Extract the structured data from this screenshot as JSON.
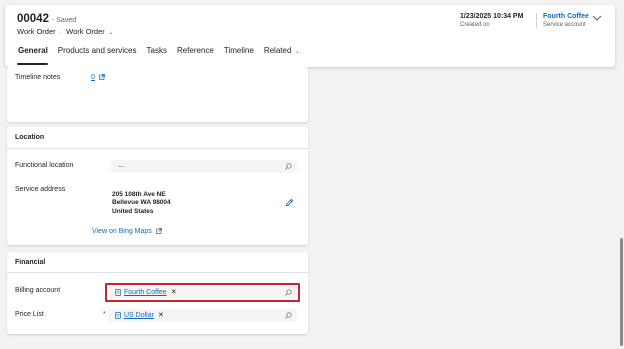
{
  "header": {
    "record_number": "00042",
    "save_status": "- Saved",
    "entity": "Work Order",
    "form": "Work Order",
    "created_on_value": "1/23/2025 10:34 PM",
    "created_on_label": "Created on",
    "service_account_value": "Fourth Coffee",
    "service_account_label": "Service account"
  },
  "tabs": [
    {
      "label": "General",
      "active": true
    },
    {
      "label": "Products and services"
    },
    {
      "label": "Tasks"
    },
    {
      "label": "Reference"
    },
    {
      "label": "Timeline"
    },
    {
      "label": "Related"
    }
  ],
  "sections": {
    "top": {
      "timeline_notes_label": "Timeline notes",
      "timeline_notes_value": "0"
    },
    "location": {
      "title": "Location",
      "functional_location_label": "Functional location",
      "functional_location_value": "---",
      "service_address_label": "Service address",
      "address_line1": "205 108th Ave NE",
      "address_line2": "Bellevue WA 98004",
      "address_line3": "United States",
      "bing_link": "View on Bing Maps"
    },
    "financial": {
      "title": "Financial",
      "billing_account_label": "Billing account",
      "billing_account_value": "Fourth Coffee",
      "price_list_label": "Price List",
      "price_list_required_marker": "*",
      "price_list_value": "US Dollar"
    }
  },
  "icons": {
    "search": "search-icon",
    "edit": "pencil-icon",
    "external": "external-link-icon",
    "lookup": "record-icon",
    "chevron": "chevron-down-icon"
  },
  "colors": {
    "link": "#0f6cbd",
    "required": "#c50f1f",
    "highlight": "#c4262e"
  }
}
